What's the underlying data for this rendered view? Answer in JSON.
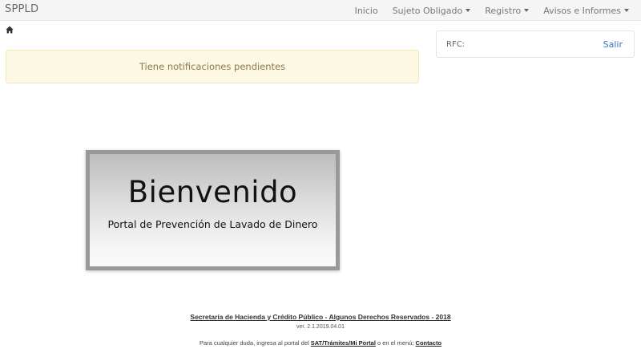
{
  "navbar": {
    "brand": "SPPLD",
    "items": [
      {
        "label": "Inicio",
        "dropdown": false
      },
      {
        "label": "Sujeto Obligado",
        "dropdown": true
      },
      {
        "label": "Registro",
        "dropdown": true
      },
      {
        "label": "Avisos e Informes",
        "dropdown": true
      }
    ]
  },
  "breadcrumb": {
    "icon": "home-icon"
  },
  "alert": {
    "message": "Tiene notificaciones pendientes",
    "color": "#fcf8e3"
  },
  "rfc_panel": {
    "label": "RFC:",
    "logout": "Salir",
    "link_color": "#3b6fc8"
  },
  "welcome": {
    "title": "Bienvenido",
    "subtitle": "Portal de Prevención de Lavado de Dinero"
  },
  "footer": {
    "copyright": "Secretaría de Hacienda y Crédito Público - Algunos Derechos Reservados - 2018",
    "version": "ver. 2.1.2019.04.01",
    "help_prefix": "Para cualquier duda, ingresa al portal del ",
    "help_link1": "SAT/Trámites/Mi Portal",
    "help_middle": " o en el menú; ",
    "help_link2": "Contacto"
  }
}
